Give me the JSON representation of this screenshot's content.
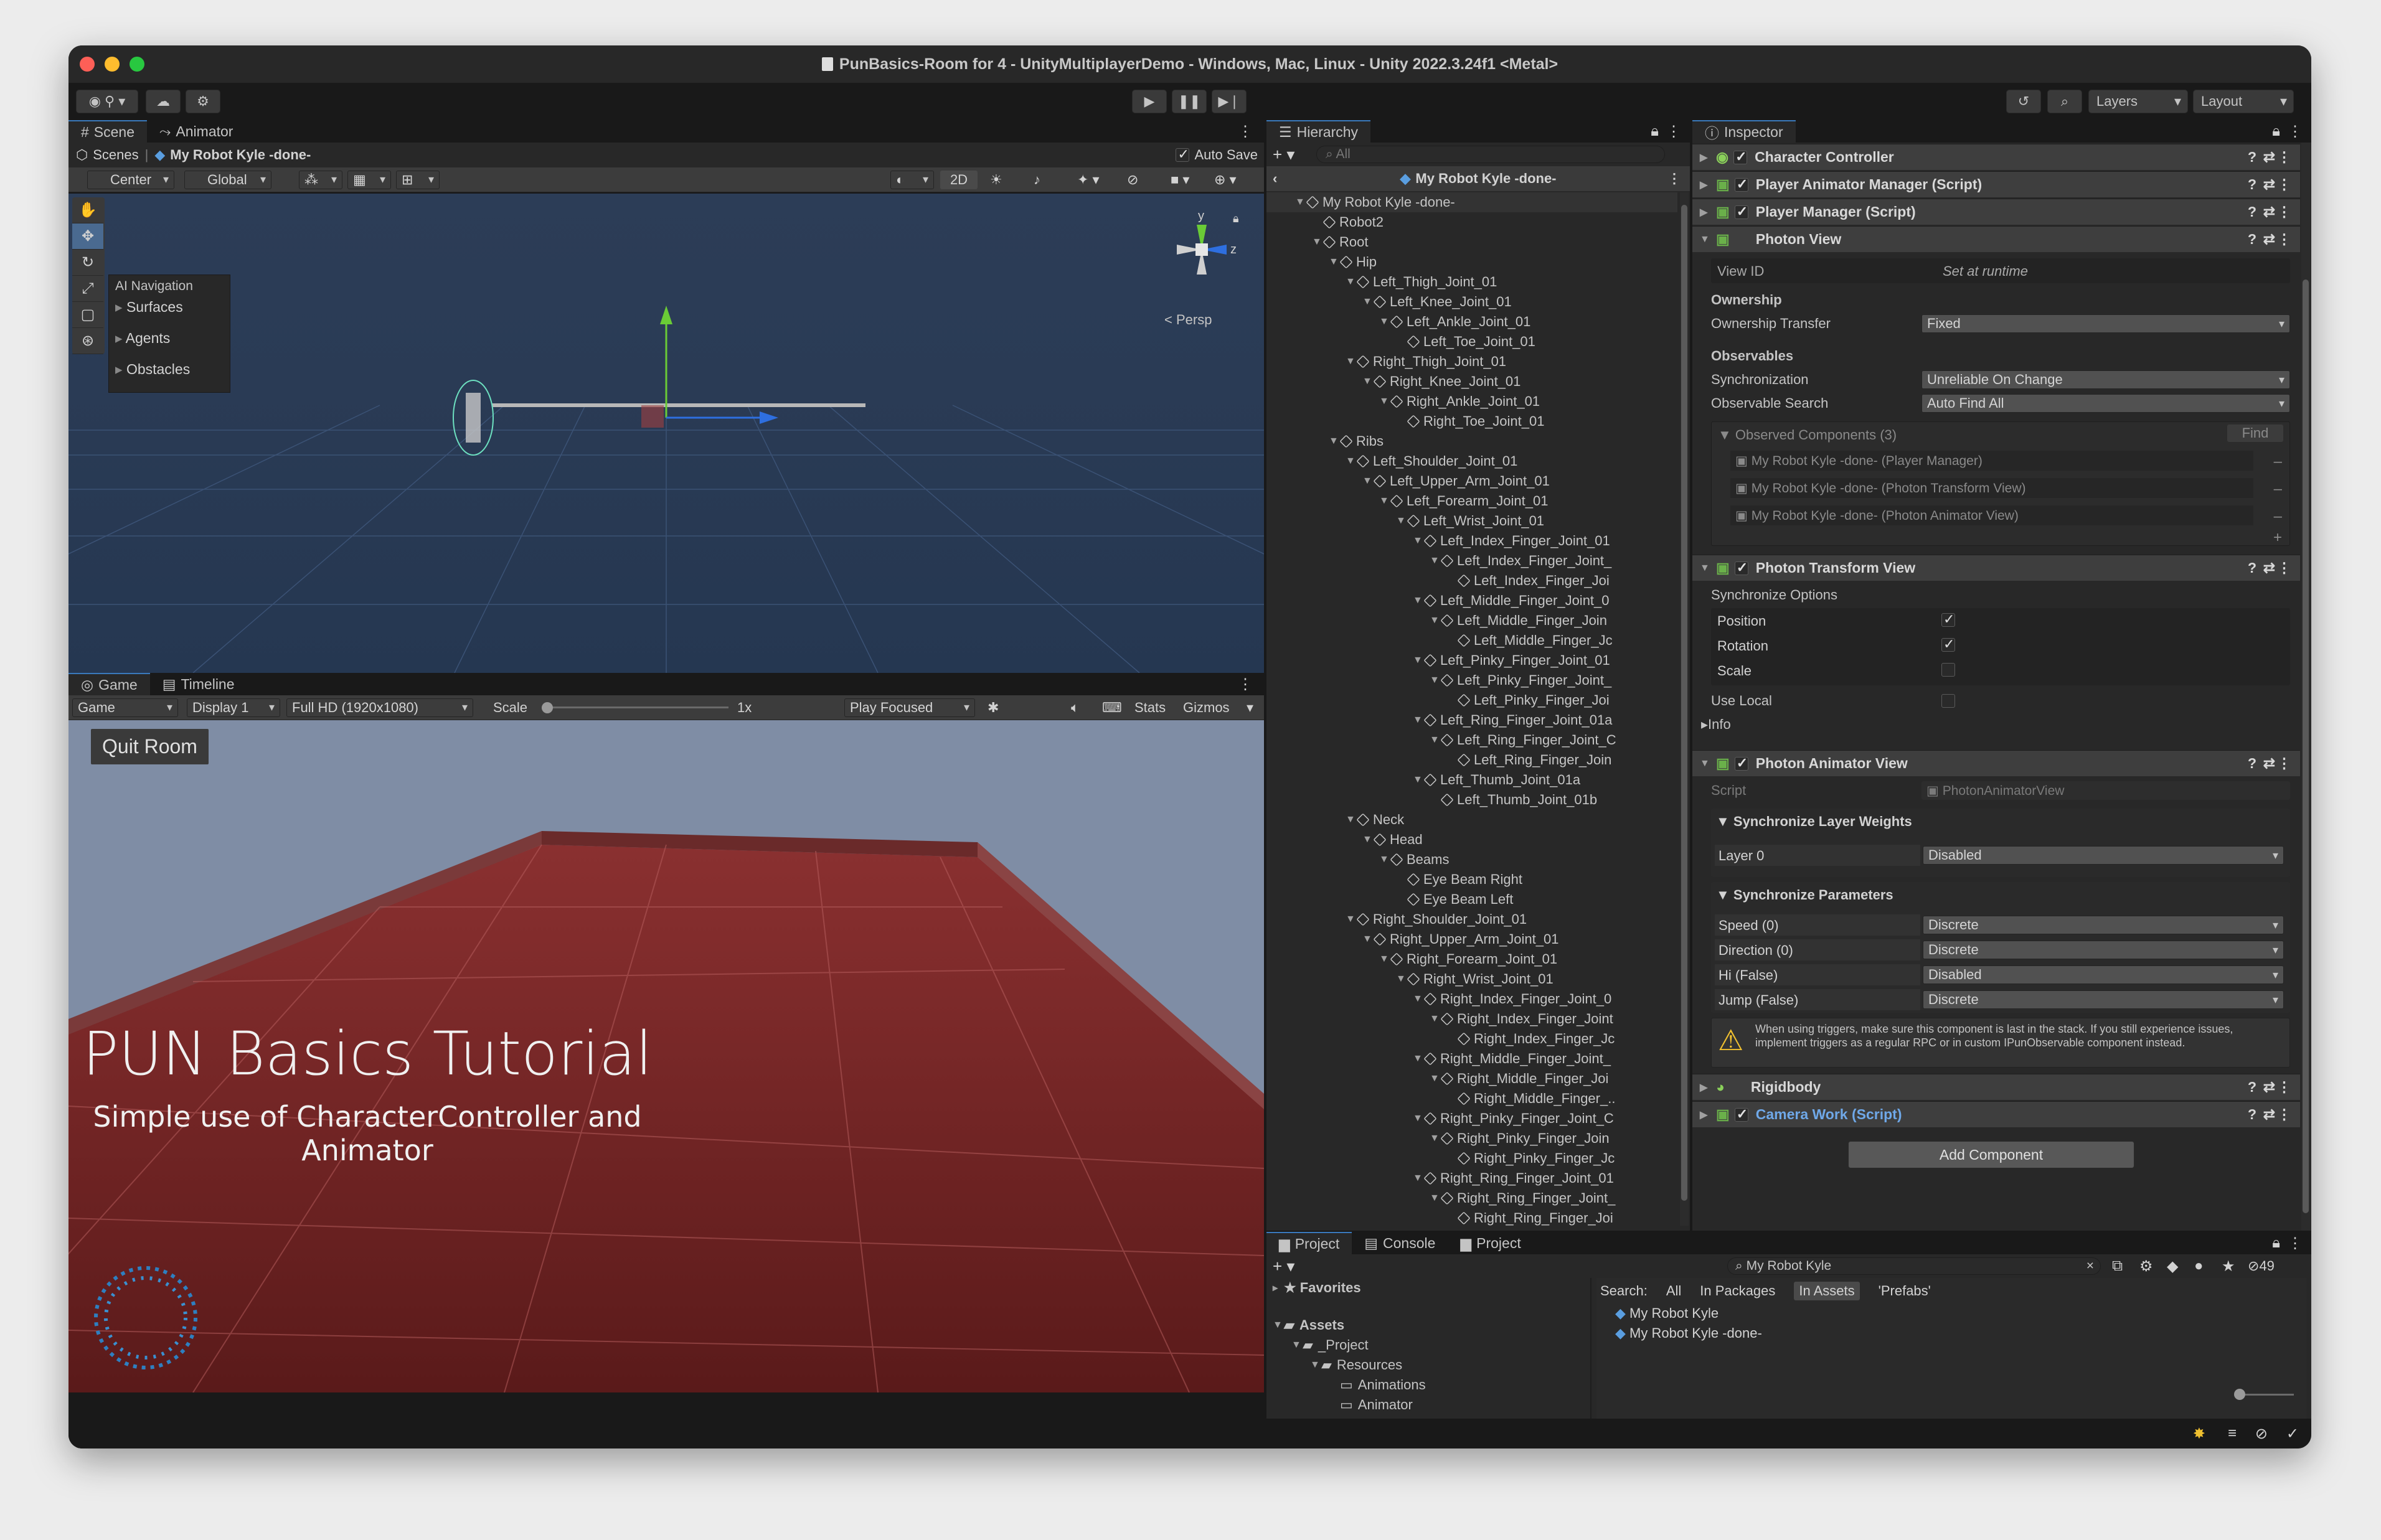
{
  "window": {
    "title": "PunBasics-Room for 4 - UnityMultiplayerDemo - Windows, Mac, Linux - Unity 2022.3.24f1 <Metal>"
  },
  "toolbar": {
    "layers_label": "Layers",
    "layout_label": "Layout"
  },
  "scene_panel": {
    "tabs": [
      "Scene",
      "Animator"
    ],
    "breadcrumb": {
      "root": "Scenes",
      "prefab": "My Robot Kyle -done-"
    },
    "auto_save_label": "Auto Save",
    "center_label": "Center",
    "global_label": "Global",
    "mode_2d": "2D",
    "persp_label": "Persp",
    "gizmo_y": "y",
    "gizmo_z": "z",
    "ai_nav": {
      "title": "AI Navigation",
      "items": [
        "Surfaces",
        "Agents",
        "Obstacles"
      ]
    }
  },
  "game_panel": {
    "tabs": [
      "Game",
      "Timeline"
    ],
    "game_dropdown": "Game",
    "display": "Display 1",
    "resolution": "Full HD (1920x1080)",
    "scale_label": "Scale",
    "scale_value": "1x",
    "play_focused": "Play Focused",
    "stats": "Stats",
    "gizmos": "Gizmos",
    "quit_room": "Quit Room",
    "headline": "PUN Basics Tutorial",
    "subheadline": "Simple use of CharacterController and Animator"
  },
  "hierarchy": {
    "tab": "Hierarchy",
    "search_placeholder": "All",
    "prefab_title": "My Robot Kyle -done-",
    "rows": [
      {
        "label": "My Robot Kyle -done-",
        "depth": 0,
        "arrow": "▼"
      },
      {
        "label": "Robot2",
        "depth": 1,
        "arrow": ""
      },
      {
        "label": "Root",
        "depth": 1,
        "arrow": "▼"
      },
      {
        "label": "Hip",
        "depth": 2,
        "arrow": "▼"
      },
      {
        "label": "Left_Thigh_Joint_01",
        "depth": 3,
        "arrow": "▼"
      },
      {
        "label": "Left_Knee_Joint_01",
        "depth": 4,
        "arrow": "▼"
      },
      {
        "label": "Left_Ankle_Joint_01",
        "depth": 5,
        "arrow": "▼"
      },
      {
        "label": "Left_Toe_Joint_01",
        "depth": 6,
        "arrow": ""
      },
      {
        "label": "Right_Thigh_Joint_01",
        "depth": 3,
        "arrow": "▼"
      },
      {
        "label": "Right_Knee_Joint_01",
        "depth": 4,
        "arrow": "▼"
      },
      {
        "label": "Right_Ankle_Joint_01",
        "depth": 5,
        "arrow": "▼"
      },
      {
        "label": "Right_Toe_Joint_01",
        "depth": 6,
        "arrow": ""
      },
      {
        "label": "Ribs",
        "depth": 2,
        "arrow": "▼"
      },
      {
        "label": "Left_Shoulder_Joint_01",
        "depth": 3,
        "arrow": "▼"
      },
      {
        "label": "Left_Upper_Arm_Joint_01",
        "depth": 4,
        "arrow": "▼"
      },
      {
        "label": "Left_Forearm_Joint_01",
        "depth": 5,
        "arrow": "▼"
      },
      {
        "label": "Left_Wrist_Joint_01",
        "depth": 6,
        "arrow": "▼"
      },
      {
        "label": "Left_Index_Finger_Joint_01",
        "depth": 7,
        "arrow": "▼"
      },
      {
        "label": "Left_Index_Finger_Joint_",
        "depth": 8,
        "arrow": "▼"
      },
      {
        "label": "Left_Index_Finger_Joi",
        "depth": 9,
        "arrow": ""
      },
      {
        "label": "Left_Middle_Finger_Joint_0",
        "depth": 7,
        "arrow": "▼"
      },
      {
        "label": "Left_Middle_Finger_Join",
        "depth": 8,
        "arrow": "▼"
      },
      {
        "label": "Left_Middle_Finger_Jc",
        "depth": 9,
        "arrow": ""
      },
      {
        "label": "Left_Pinky_Finger_Joint_01",
        "depth": 7,
        "arrow": "▼"
      },
      {
        "label": "Left_Pinky_Finger_Joint_",
        "depth": 8,
        "arrow": "▼"
      },
      {
        "label": "Left_Pinky_Finger_Joi",
        "depth": 9,
        "arrow": ""
      },
      {
        "label": "Left_Ring_Finger_Joint_01a",
        "depth": 7,
        "arrow": "▼"
      },
      {
        "label": "Left_Ring_Finger_Joint_C",
        "depth": 8,
        "arrow": "▼"
      },
      {
        "label": "Left_Ring_Finger_Join",
        "depth": 9,
        "arrow": ""
      },
      {
        "label": "Left_Thumb_Joint_01a",
        "depth": 7,
        "arrow": "▼"
      },
      {
        "label": "Left_Thumb_Joint_01b",
        "depth": 8,
        "arrow": ""
      },
      {
        "label": "Neck",
        "depth": 3,
        "arrow": "▼"
      },
      {
        "label": "Head",
        "depth": 4,
        "arrow": "▼"
      },
      {
        "label": "Beams",
        "depth": 5,
        "arrow": "▼"
      },
      {
        "label": "Eye Beam Right",
        "depth": 6,
        "arrow": ""
      },
      {
        "label": "Eye Beam Left",
        "depth": 6,
        "arrow": ""
      },
      {
        "label": "Right_Shoulder_Joint_01",
        "depth": 3,
        "arrow": "▼"
      },
      {
        "label": "Right_Upper_Arm_Joint_01",
        "depth": 4,
        "arrow": "▼"
      },
      {
        "label": "Right_Forearm_Joint_01",
        "depth": 5,
        "arrow": "▼"
      },
      {
        "label": "Right_Wrist_Joint_01",
        "depth": 6,
        "arrow": "▼"
      },
      {
        "label": "Right_Index_Finger_Joint_0",
        "depth": 7,
        "arrow": "▼"
      },
      {
        "label": "Right_Index_Finger_Joint",
        "depth": 8,
        "arrow": "▼"
      },
      {
        "label": "Right_Index_Finger_Jc",
        "depth": 9,
        "arrow": ""
      },
      {
        "label": "Right_Middle_Finger_Joint_",
        "depth": 7,
        "arrow": "▼"
      },
      {
        "label": "Right_Middle_Finger_Joi",
        "depth": 8,
        "arrow": "▼"
      },
      {
        "label": "Right_Middle_Finger_..",
        "depth": 9,
        "arrow": ""
      },
      {
        "label": "Right_Pinky_Finger_Joint_C",
        "depth": 7,
        "arrow": "▼"
      },
      {
        "label": "Right_Pinky_Finger_Join",
        "depth": 8,
        "arrow": "▼"
      },
      {
        "label": "Right_Pinky_Finger_Jc",
        "depth": 9,
        "arrow": ""
      },
      {
        "label": "Right_Ring_Finger_Joint_01",
        "depth": 7,
        "arrow": "▼"
      },
      {
        "label": "Right_Ring_Finger_Joint_",
        "depth": 8,
        "arrow": "▼"
      },
      {
        "label": "Right_Ring_Finger_Joi",
        "depth": 9,
        "arrow": ""
      }
    ]
  },
  "inspector": {
    "tab": "Inspector",
    "components_top": [
      "Character Controller",
      "Player Animator Manager (Script)",
      "Player Manager (Script)"
    ],
    "photon_view": {
      "title": "Photon View",
      "view_id_label": "View ID",
      "view_id_value": "Set at runtime",
      "ownership_header": "Ownership",
      "ownership_transfer_label": "Ownership Transfer",
      "ownership_transfer_value": "Fixed",
      "observables_header": "Observables",
      "sync_label": "Synchronization",
      "sync_value": "Unreliable On Change",
      "obs_search_label": "Observable Search",
      "obs_search_value": "Auto Find All",
      "observed_header": "Observed Components (3)",
      "find_label": "Find",
      "observed": [
        "My Robot Kyle -done- (Player Manager)",
        "My Robot Kyle -done- (Photon Transform View)",
        "My Robot Kyle -done- (Photon Animator View)"
      ]
    },
    "transform_view": {
      "title": "Photon Transform View",
      "sync_options": "Synchronize Options",
      "position": "Position",
      "rotation": "Rotation",
      "scale": "Scale",
      "use_local": "Use Local",
      "info": "Info"
    },
    "animator_view": {
      "title": "Photon Animator View",
      "script_label": "Script",
      "script_value": "PhotonAnimatorView",
      "layer_weights_header": "Synchronize Layer Weights",
      "layers": [
        {
          "name": "Layer 0",
          "value": "Disabled"
        }
      ],
      "params_header": "Synchronize Parameters",
      "params": [
        {
          "name": "Speed (0)",
          "value": "Discrete"
        },
        {
          "name": "Direction (0)",
          "value": "Discrete"
        },
        {
          "name": "Hi (False)",
          "value": "Disabled"
        },
        {
          "name": "Jump (False)",
          "value": "Discrete"
        }
      ],
      "warning": "When using triggers, make sure this component is last in the stack. If you still experience issues, implement triggers as a regular RPC or in custom IPunObservable component instead."
    },
    "rigidbody": "Rigidbody",
    "camera_work": "Camera Work (Script)",
    "add_component": "Add Component"
  },
  "project": {
    "tabs": [
      "Project",
      "Console",
      "Project"
    ],
    "search_value": "My Robot Kyle",
    "hidden_count": "49",
    "favorites": "Favorites",
    "tree": [
      {
        "label": "Assets",
        "depth": 0,
        "bold": true
      },
      {
        "label": "_Project",
        "depth": 1,
        "bold": false
      },
      {
        "label": "Resources",
        "depth": 2,
        "bold": false
      },
      {
        "label": "Animations",
        "depth": 3,
        "bold": false
      },
      {
        "label": "Animator",
        "depth": 3,
        "bold": false
      }
    ],
    "search_label": "Search:",
    "search_scopes": [
      "All",
      "In Packages",
      "In Assets",
      "'Prefabs'"
    ],
    "active_scope": "In Assets",
    "results": [
      "My Robot Kyle",
      "My Robot Kyle -done-"
    ]
  },
  "colors": {
    "accent": "#3a79bb",
    "link": "#6fa8e8",
    "bg_dark": "#191919",
    "panel": "#282828"
  }
}
